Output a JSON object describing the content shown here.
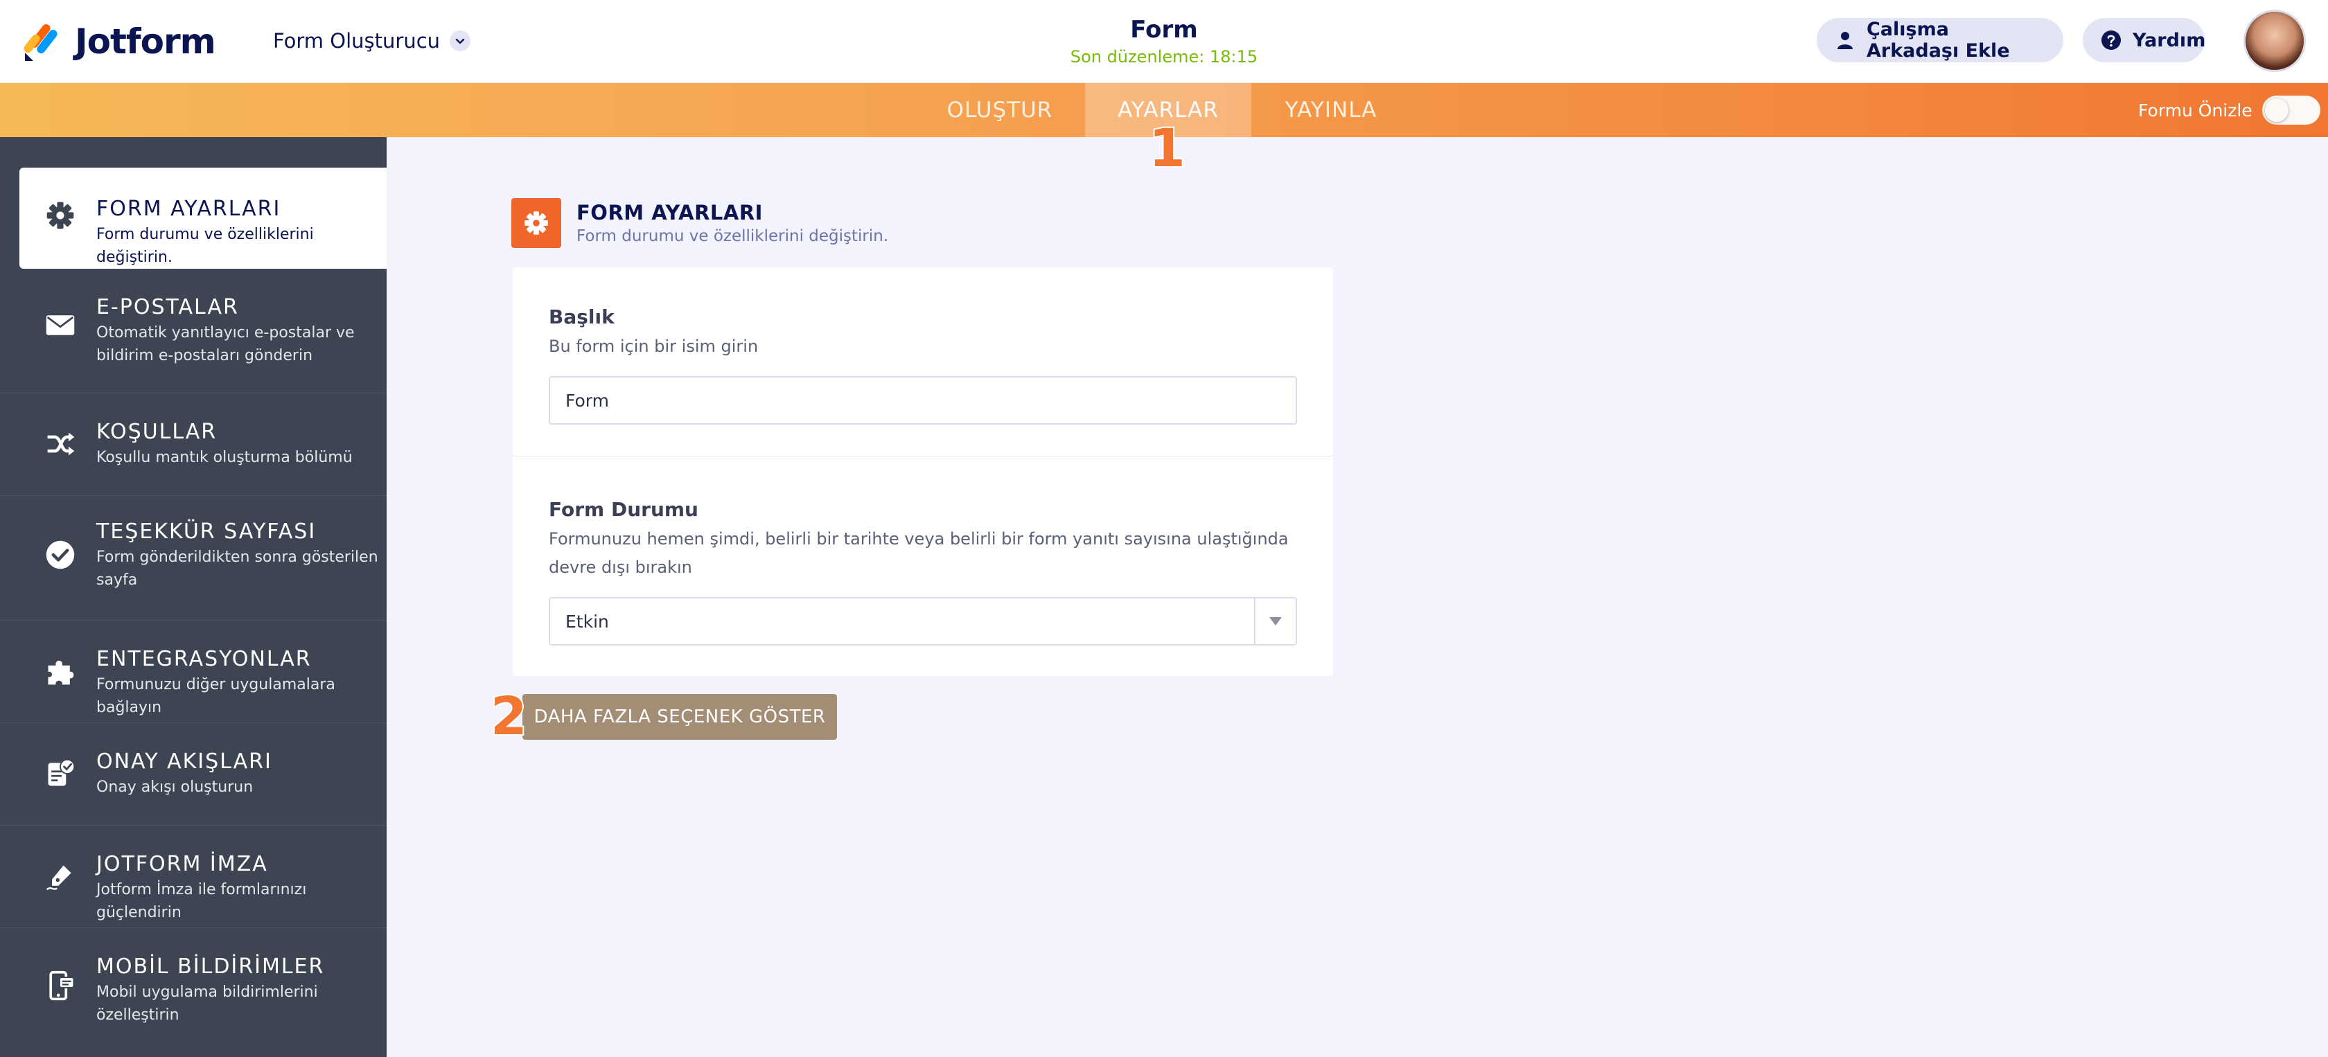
{
  "brand": {
    "name": "Jotform"
  },
  "header": {
    "builder_menu": "Form Oluşturucu",
    "form_title": "Form",
    "last_edited": "Son düzenleme: 18:15",
    "add_collaborator": "Çalışma Arkadaşı Ekle",
    "help": "Yardım"
  },
  "nav": {
    "tabs": [
      "OLUŞTUR",
      "AYARLAR",
      "YAYINLA"
    ],
    "active_tab": "AYARLAR",
    "preview_label": "Formu Önizle",
    "preview_enabled": false
  },
  "annotations": [
    "1",
    "2"
  ],
  "sidebar": {
    "items": [
      {
        "title": "FORM AYARLARI",
        "desc": "Form durumu ve özelliklerini değiştirin.",
        "icon": "gear-icon",
        "active": true
      },
      {
        "title": "E-POSTALAR",
        "desc": "Otomatik yanıtlayıcı e-postalar ve bildirim e-postaları gönderin",
        "icon": "envelope-icon"
      },
      {
        "title": "KOŞULLAR",
        "desc": "Koşullu mantık oluşturma bölümü",
        "icon": "shuffle-icon"
      },
      {
        "title": "TEŞEKKÜR SAYFASI",
        "desc": "Form gönderildikten sonra gösterilen sayfa",
        "icon": "check-circle-icon"
      },
      {
        "title": "ENTEGRASYONLAR",
        "desc": "Formunuzu diğer uygulamalara bağlayın",
        "icon": "puzzle-icon"
      },
      {
        "title": "ONAY AKIŞLARI",
        "desc": "Onay akışı oluşturun",
        "icon": "approval-doc-icon"
      },
      {
        "title": "JOTFORM İMZA",
        "desc": "Jotform İmza ile formlarınızı güçlendirin",
        "icon": "pen-icon"
      },
      {
        "title": "MOBİL BİLDİRİMLER",
        "desc": "Mobil uygulama bildirimlerini özelleştirin",
        "icon": "mobile-notification-icon"
      }
    ]
  },
  "main": {
    "section_title": "FORM AYARLARI",
    "section_subtitle": "Form durumu ve özelliklerini değiştirin.",
    "title_field": {
      "label": "Başlık",
      "desc": "Bu form için bir isim girin",
      "value": "Form"
    },
    "status_field": {
      "label": "Form Durumu",
      "desc": "Formunuzu hemen şimdi, belirli bir tarihte veya belirli bir form yanıtı sayısına ulaştığında devre dışı bırakın",
      "value": "Etkin"
    },
    "more_options": "DAHA FAZLA SEÇENEK GÖSTER"
  },
  "colors": {
    "accent_orange": "#f06529",
    "sidebar_bg": "#3e4552",
    "last_edit_green": "#78bb07",
    "more_button": "#a38d74"
  }
}
